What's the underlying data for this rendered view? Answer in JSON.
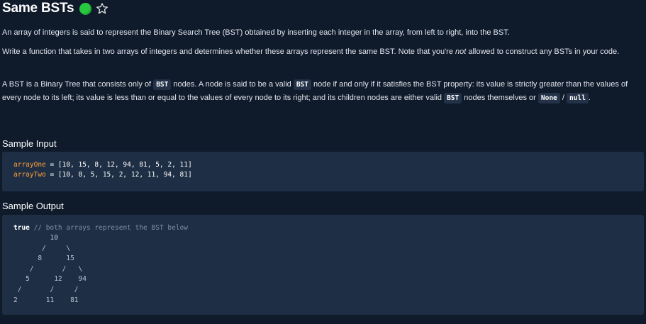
{
  "header": {
    "title": "Same BSTs"
  },
  "icons": {
    "status": "green-circle-icon",
    "favorite": "star-outline-icon"
  },
  "colors": {
    "background": "#0f1a2b",
    "code_bg": "#1e2f45",
    "status_green": "#27c93f",
    "variable": "#ff9f3a",
    "comment": "#7f8da3"
  },
  "description": {
    "p1": "An array of integers is said to represent the Binary Search Tree (BST) obtained by inserting each integer in the array, from left to right, into the BST.",
    "p2_a": "Write a function that takes in two arrays of integers and determines whether these arrays represent the same BST. Note that you're ",
    "p2_em": "not",
    "p2_b": " allowed to construct any BSTs in your code.",
    "p3_a": "A BST is a Binary Tree that consists only of ",
    "p3_code1": "BST",
    "p3_b": " nodes. A node is said to be a valid ",
    "p3_code2": "BST",
    "p3_c": " node if and only if it satisfies the BST property: its value is strictly greater than the values of every node to its left; its value is less than or equal to the values of every node to its right; and its children nodes are either valid ",
    "p3_code3": "BST",
    "p3_d": " nodes themselves or ",
    "p3_code4": "None",
    "p3_e": " / ",
    "p3_code5": "null",
    "p3_f": "."
  },
  "sample_input": {
    "title": "Sample Input",
    "line1_var": "arrayOne",
    "line1_rest": " = [10, 15, 8, 12, 94, 81, 5, 2, 11]",
    "line2_var": "arrayTwo",
    "line2_rest": " = [10, 8, 5, 15, 2, 12, 11, 94, 81]"
  },
  "sample_output": {
    "title": "Sample Output",
    "result": "true",
    "comment": " // both arrays represent the BST below",
    "tree": "         10\n       /     \\\n      8      15\n    /       /   \\\n   5      12    94\n /       /     /\n2       11    81"
  }
}
